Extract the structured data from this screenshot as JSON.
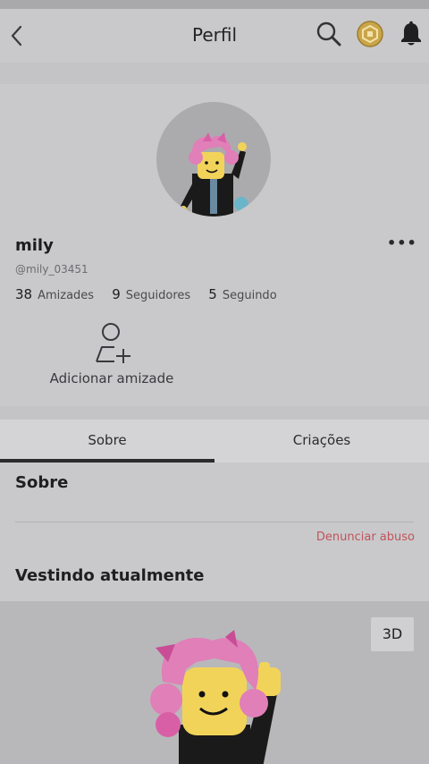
{
  "header": {
    "title": "Perfil"
  },
  "icons": {
    "back": "chevron-left-icon",
    "search": "search-icon",
    "robux": "robux-coin-icon",
    "notifications": "bell-icon",
    "more": "more-options-icon",
    "add_friend": "add-friend-icon"
  },
  "profile": {
    "display_name": "mily",
    "username": "@mily_03451",
    "more_label": "•••",
    "stats": [
      {
        "count": "38",
        "label": "Amizades"
      },
      {
        "count": "9",
        "label": "Seguidores"
      },
      {
        "count": "5",
        "label": "Seguindo"
      }
    ],
    "add_friend_label": "Adicionar amizade"
  },
  "tabs": [
    {
      "label": "Sobre",
      "active": true
    },
    {
      "label": "Criações",
      "active": false
    }
  ],
  "about": {
    "heading": "Sobre",
    "report_label": "Denunciar abuso",
    "wearing_heading": "Vestindo atualmente",
    "view3d_label": "3D"
  },
  "colors": {
    "report": "#c0545b",
    "avatar_hair": "#e07fb8",
    "coin": "#c9a54a"
  }
}
